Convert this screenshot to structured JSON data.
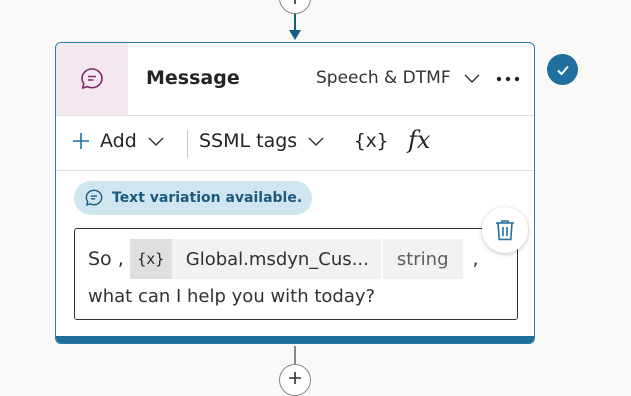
{
  "node": {
    "title": "Message",
    "channel": "Speech & DTMF",
    "more_label": "..."
  },
  "toolbar": {
    "add_label": "Add",
    "ssml_label": "SSML tags",
    "variable_label": "{x}",
    "formula_label": "fx"
  },
  "variation_badge": {
    "text": "Text variation available."
  },
  "message": {
    "prefix": "So ,",
    "variable": {
      "icon_text": "{x}",
      "name": "Global.msdyn_Cus...",
      "type": "string"
    },
    "suffix": ",",
    "line2": "what can I help you with today?"
  },
  "colors": {
    "accent": "#1f6f9f",
    "icon_bg": "#f3e7f0",
    "badge_bg": "#cfe6f0",
    "badge_text": "#1b5a7c"
  },
  "icons": {
    "message": "chat-bubble-icon",
    "add": "plus-icon",
    "check": "check-icon",
    "delete": "trash-icon"
  }
}
